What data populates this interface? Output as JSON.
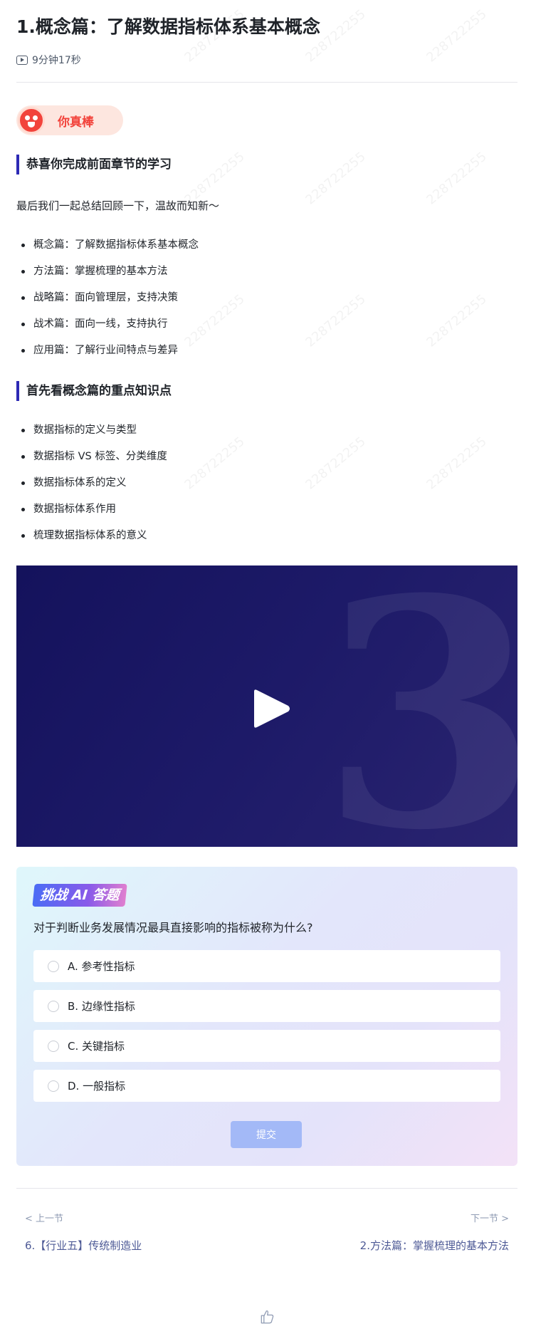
{
  "lesson": {
    "title": "1.概念篇：了解数据指标体系基本概念",
    "duration": "9分钟17秒"
  },
  "praise": {
    "text": "你真棒"
  },
  "review": {
    "heading": "恭喜你完成前面章节的学习",
    "intro": "最后我们一起总结回顾一下，温故而知新～",
    "items": [
      "概念篇：了解数据指标体系基本概念",
      "方法篇：掌握梳理的基本方法",
      "战略篇：面向管理层，支持决策",
      "战术篇：面向一线，支持执行",
      "应用篇：了解行业间特点与差异"
    ]
  },
  "key_points": {
    "heading": "首先看概念篇的重点知识点",
    "items": [
      "数据指标的定义与类型",
      "数据指标 VS 标签、分类维度",
      "数据指标体系的定义",
      "数据指标体系作用",
      "梳理数据指标体系的意义"
    ]
  },
  "video": {
    "decor_glyph": "3"
  },
  "quiz": {
    "tag": "挑战 AI 答题",
    "question": "对于判断业务发展情况最具直接影响的指标被称为什么?",
    "options": [
      "A. 参考性指标",
      "B. 边缘性指标",
      "C. 关键指标",
      "D. 一般指标"
    ],
    "submit_label": "提交"
  },
  "navigation": {
    "prev_label": "< 上一节",
    "prev_title": "6.【行业五】传统制造业",
    "next_label": "下一节 >",
    "next_title": "2.方法篇：掌握梳理的基本方法"
  },
  "watermark": "228722255",
  "colors": {
    "accent_bar": "#2d2ab5",
    "praise_red": "#f2433b",
    "submit_disabled": "#a3b9f7",
    "nav_link": "#4e5a96"
  }
}
